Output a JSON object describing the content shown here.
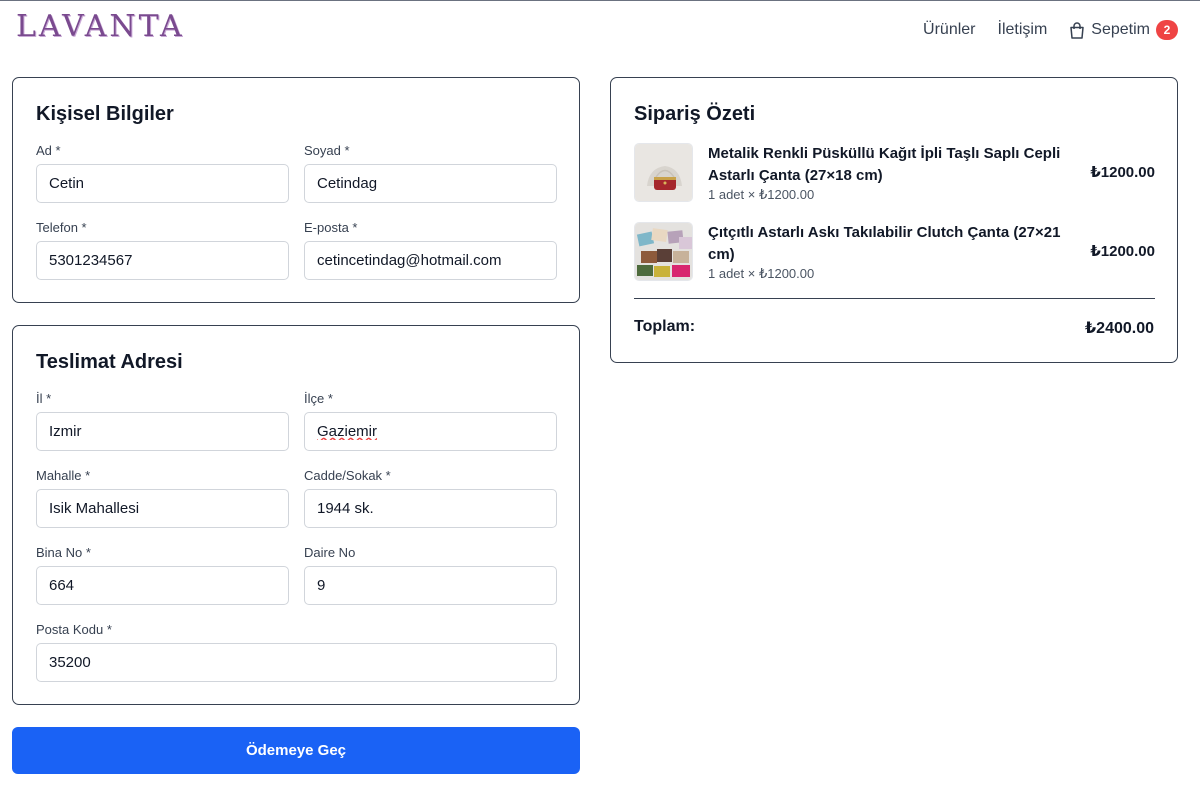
{
  "brand": {
    "logo_text": "LAVANTA"
  },
  "nav": {
    "products": "Ürünler",
    "contact": "İletişim",
    "cart_label": "Sepetim",
    "cart_count": "2"
  },
  "personal": {
    "title": "Kişisel Bilgiler",
    "first_name": {
      "label": "Ad *",
      "value": "Cetin"
    },
    "last_name": {
      "label": "Soyad *",
      "value": "Cetindag"
    },
    "phone": {
      "label": "Telefon *",
      "value": "5301234567"
    },
    "email": {
      "label": "E-posta *",
      "value": "cetincetindag@hotmail.com"
    }
  },
  "address": {
    "title": "Teslimat Adresi",
    "city": {
      "label": "İl *",
      "value": "Izmir"
    },
    "district": {
      "label": "İlçe *",
      "value": "Gaziemir"
    },
    "neighborhood": {
      "label": "Mahalle *",
      "value": "Isik Mahallesi"
    },
    "street": {
      "label": "Cadde/Sokak *",
      "value": "1944 sk."
    },
    "building": {
      "label": "Bina No *",
      "value": "664"
    },
    "apartment": {
      "label": "Daire No",
      "value": "9"
    },
    "postal_code": {
      "label": "Posta Kodu *",
      "value": "35200"
    }
  },
  "submit_label": "Ödemeye Geç",
  "summary": {
    "title": "Sipariş Özeti",
    "items": [
      {
        "name": "Metalik Renkli Püsküllü Kağıt İpli Taşlı Saplı Cepli Astarlı Çanta (27×18 cm)",
        "qty": "1 adet × ₺1200.00",
        "price": "₺1200.00"
      },
      {
        "name": "Çıtçıtlı Astarlı Askı Takılabilir Clutch Çanta (27×21 cm)",
        "qty": "1 adet × ₺1200.00",
        "price": "₺1200.00"
      }
    ],
    "total_label": "Toplam:",
    "total_value": "₺2400.00"
  },
  "colors": {
    "primary_button": "#1a62f5",
    "badge": "#ef4444",
    "logo": "#7a4a8f"
  }
}
